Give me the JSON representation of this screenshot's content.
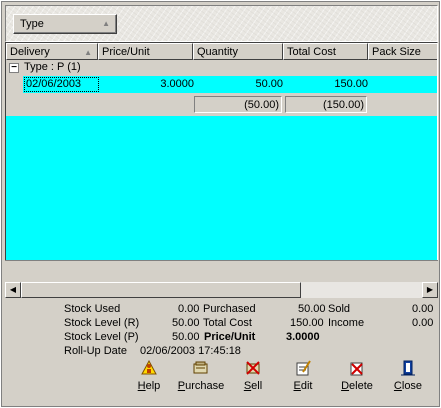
{
  "group_by": {
    "chip_label": "Type"
  },
  "columns": [
    {
      "label": "Delivery"
    },
    {
      "label": "Price/Unit"
    },
    {
      "label": "Quantity"
    },
    {
      "label": "Total Cost"
    },
    {
      "label": "Pack Size"
    }
  ],
  "group_row": {
    "expander": "−",
    "label": "Type : P  (1)"
  },
  "rows": [
    {
      "delivery": "02/06/2003",
      "price_unit": "3.0000",
      "quantity": "50.00",
      "total_cost": "150.00"
    }
  ],
  "summary": {
    "quantity": "(50.00)",
    "total_cost": "(150.00)"
  },
  "stats": {
    "stock_used_label": "Stock Used",
    "stock_used_value": "0.00",
    "purchased_label": "Purchased",
    "purchased_value": "50.00",
    "sold_label": "Sold",
    "sold_value": "0.00",
    "stock_level_r_label": "Stock Level (R)",
    "stock_level_r_value": "50.00",
    "total_cost_label": "Total Cost",
    "total_cost_value": "150.00",
    "income_label": "Income",
    "income_value": "0.00",
    "stock_level_p_label": "Stock Level (P)",
    "stock_level_p_value": "50.00",
    "price_unit_label": "Price/Unit",
    "price_unit_value": "3.0000",
    "rollup_label": "Roll-Up Date",
    "rollup_value": "02/06/2003 17:45:18"
  },
  "toolbar": {
    "help": {
      "first": "H",
      "rest": "elp",
      "icon": "help-icon"
    },
    "purchase": {
      "first": "P",
      "rest": "urchase",
      "icon": "purchase-icon"
    },
    "sell": {
      "first": "S",
      "rest": "ell",
      "icon": "sell-icon"
    },
    "edit": {
      "first": "E",
      "rest": "dit",
      "icon": "edit-icon"
    },
    "delete": {
      "first": "D",
      "rest": "elete",
      "icon": "delete-icon"
    },
    "close": {
      "first": "C",
      "rest": "lose",
      "icon": "close-icon"
    }
  },
  "colors": {
    "row_highlight": "#00ffff",
    "face": "#d4d0c8"
  }
}
